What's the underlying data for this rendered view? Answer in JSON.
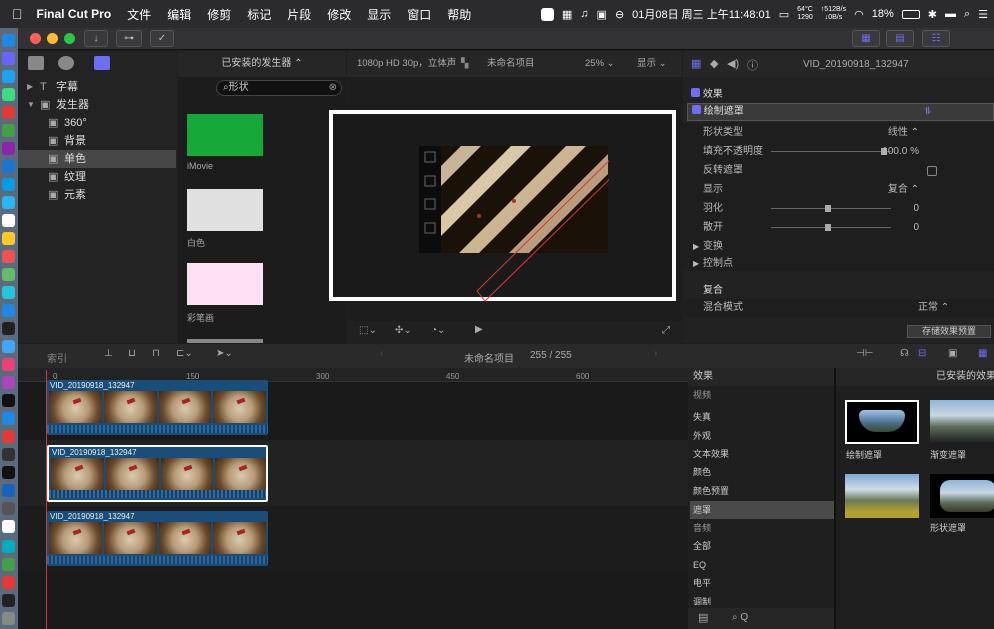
{
  "menubar": {
    "app": "Final Cut Pro",
    "items": [
      "文件",
      "编辑",
      "修剪",
      "标记",
      "片段",
      "修改",
      "显示",
      "窗口",
      "帮助"
    ],
    "clock": "01月08日 周三 上午11:48:01",
    "temp": "64°C",
    "rpm": "1290",
    "net_up": "↑512B/s",
    "net_down": "↓0B/s",
    "battery": "18%"
  },
  "sidebar": {
    "items": [
      {
        "label": "字幕"
      },
      {
        "label": "发生器"
      },
      {
        "label": "360°"
      },
      {
        "label": "背景"
      },
      {
        "label": "单色"
      },
      {
        "label": "纹理"
      },
      {
        "label": "元素"
      }
    ]
  },
  "generators": {
    "header": "已安装的发生器",
    "search_value": "形状",
    "items": [
      {
        "label": "iMovie",
        "color": "#17a83a"
      },
      {
        "label": "白色",
        "color": "#e0e0e0"
      },
      {
        "label": "彩笔画",
        "color": "#fde0f2"
      }
    ]
  },
  "viewer": {
    "format": "1080p HD 30p，立体声",
    "project": "未命名项目",
    "zoom": "25%",
    "display": "显示"
  },
  "inspector": {
    "clip_name": "VID_20190918_132947",
    "section_effects": "效果",
    "effect_name": "绘制遮罩",
    "rows": [
      {
        "label": "形状类型",
        "value": "线性 ⌃"
      },
      {
        "label": "填充不透明度",
        "value": "100.0  %"
      },
      {
        "label": "反转遮罩",
        "value": ""
      },
      {
        "label": "显示",
        "value": "复合 ⌃"
      },
      {
        "label": "羽化",
        "value": "0"
      },
      {
        "label": "散开",
        "value": "0"
      },
      {
        "label": "变换",
        "value": ""
      },
      {
        "label": "控制点",
        "value": ""
      }
    ],
    "section_composite": "复合",
    "blend_label": "混合模式",
    "blend_value": "正常 ⌃",
    "save_preset": "存储效果预置"
  },
  "timeline": {
    "index": "索引",
    "project": "未命名项目",
    "frames": "255 / 255",
    "ticks": [
      "0",
      "150",
      "300",
      "450",
      "600"
    ],
    "clips": [
      {
        "name": "VID_20190918_132947"
      },
      {
        "name": "VID_20190918_132947"
      },
      {
        "name": "VID_20190918_132947"
      }
    ]
  },
  "effects_browser": {
    "header": "效果",
    "installed": "已安装的效果",
    "categories": [
      {
        "label": "视频",
        "sub": true
      },
      {
        "label": "失真"
      },
      {
        "label": "外观"
      },
      {
        "label": "文本效果"
      },
      {
        "label": "颜色"
      },
      {
        "label": "颜色预置"
      },
      {
        "label": "遮罩",
        "selected": true
      },
      {
        "label": "音频",
        "sub": true
      },
      {
        "label": "全部"
      },
      {
        "label": "EQ"
      },
      {
        "label": "电平"
      },
      {
        "label": "调制"
      }
    ],
    "effects": [
      {
        "label": "绘制遮罩"
      },
      {
        "label": "渐变遮罩"
      },
      {
        "label": ""
      },
      {
        "label": "形状遮罩"
      }
    ],
    "search_placeholder": "Q"
  },
  "colors": {
    "accent": "#5b5ce6",
    "selection_red": "#e0333b"
  }
}
